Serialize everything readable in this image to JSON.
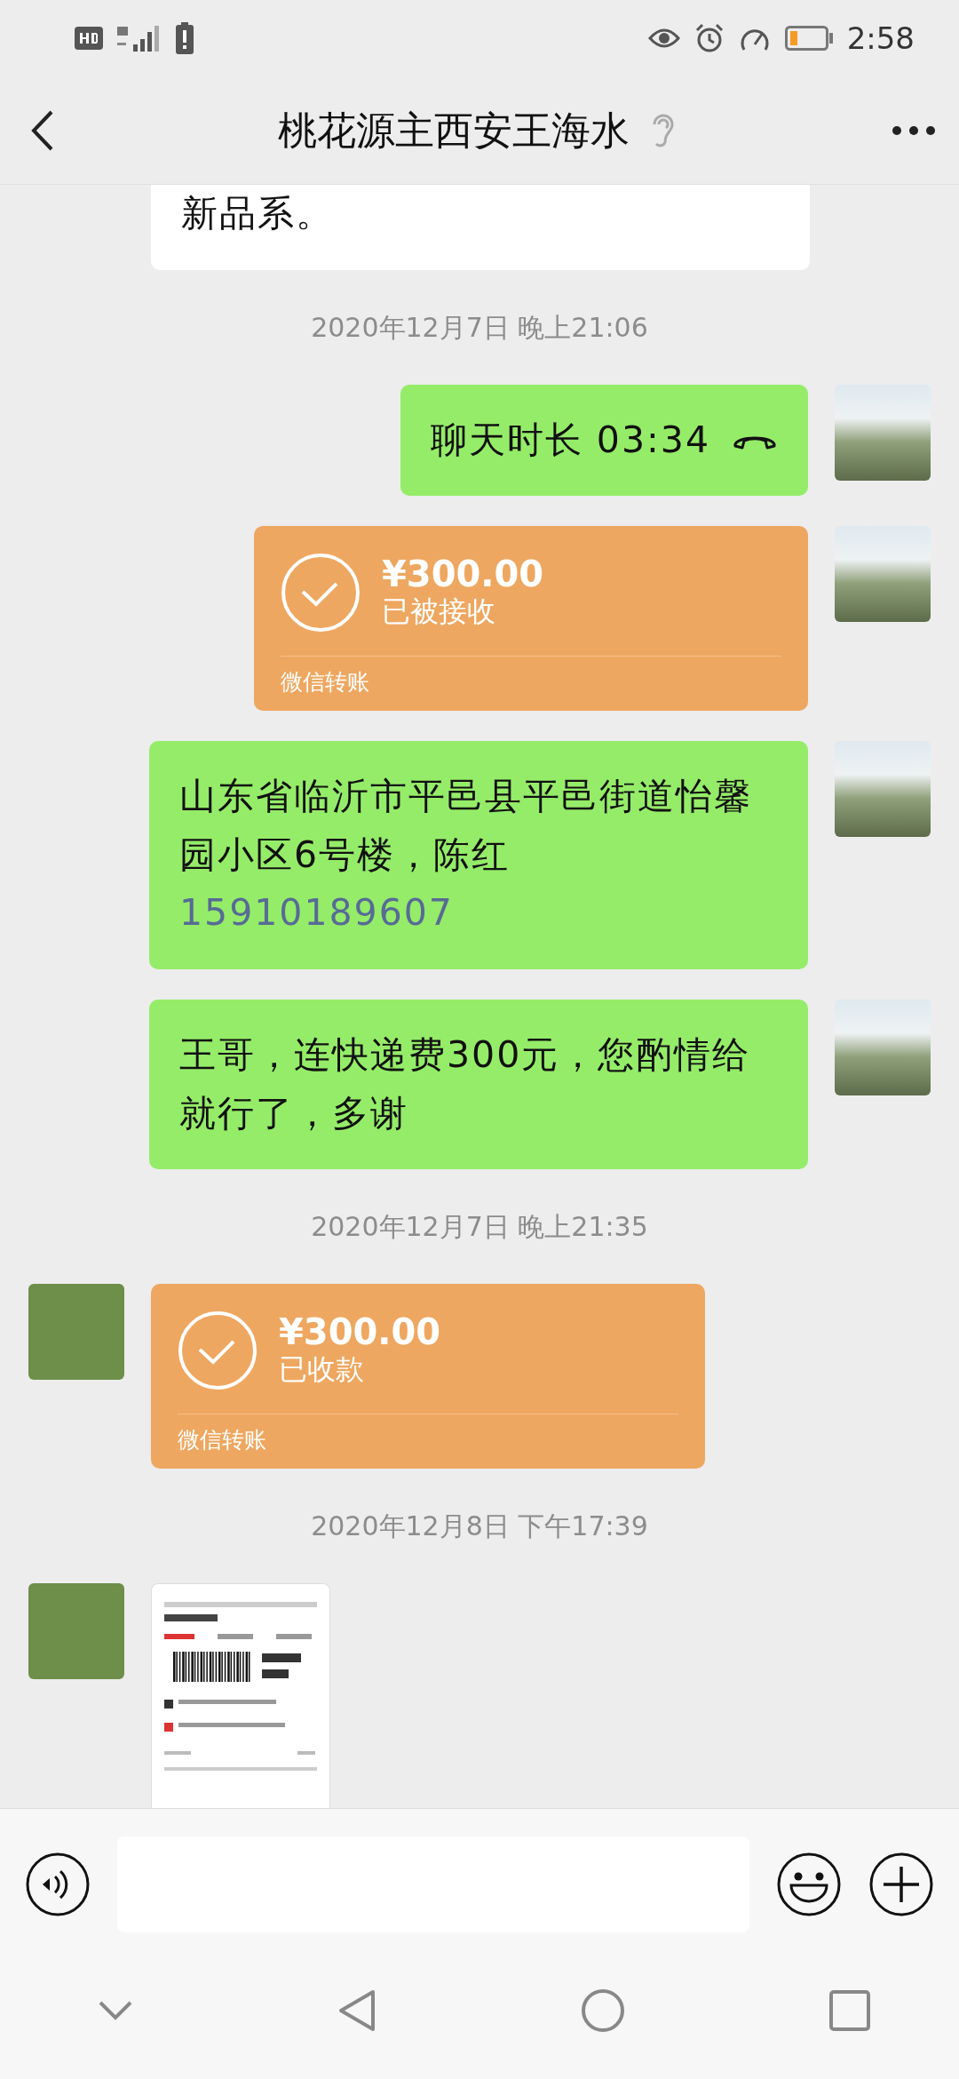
{
  "status_bar": {
    "time": "2:58"
  },
  "header": {
    "title": "桃花源主西安王海水"
  },
  "messages": [
    {
      "kind": "text",
      "outgoing": false,
      "text": "新品系。",
      "cut_top": true
    },
    {
      "kind": "time",
      "text": "2020年12月7日 晚上21:06"
    },
    {
      "kind": "call",
      "outgoing": true,
      "text": "聊天时长 03:34"
    },
    {
      "kind": "transfer",
      "outgoing": true,
      "amount": "¥300.00",
      "status": "已被接收",
      "footer": "微信转账"
    },
    {
      "kind": "text",
      "outgoing": true,
      "text": "山东省临沂市平邑县平邑街道怡馨园小区6号楼，陈红",
      "link": "15910189607"
    },
    {
      "kind": "text",
      "outgoing": true,
      "text": "王哥，连快递费300元，您酌情给就行了，多谢"
    },
    {
      "kind": "time",
      "text": "2020年12月7日 晚上21:35"
    },
    {
      "kind": "transfer",
      "outgoing": false,
      "amount": "¥300.00",
      "status": "已收款",
      "footer": "微信转账"
    },
    {
      "kind": "time",
      "text": "2020年12月8日 下午17:39"
    },
    {
      "kind": "image",
      "outgoing": false
    }
  ]
}
